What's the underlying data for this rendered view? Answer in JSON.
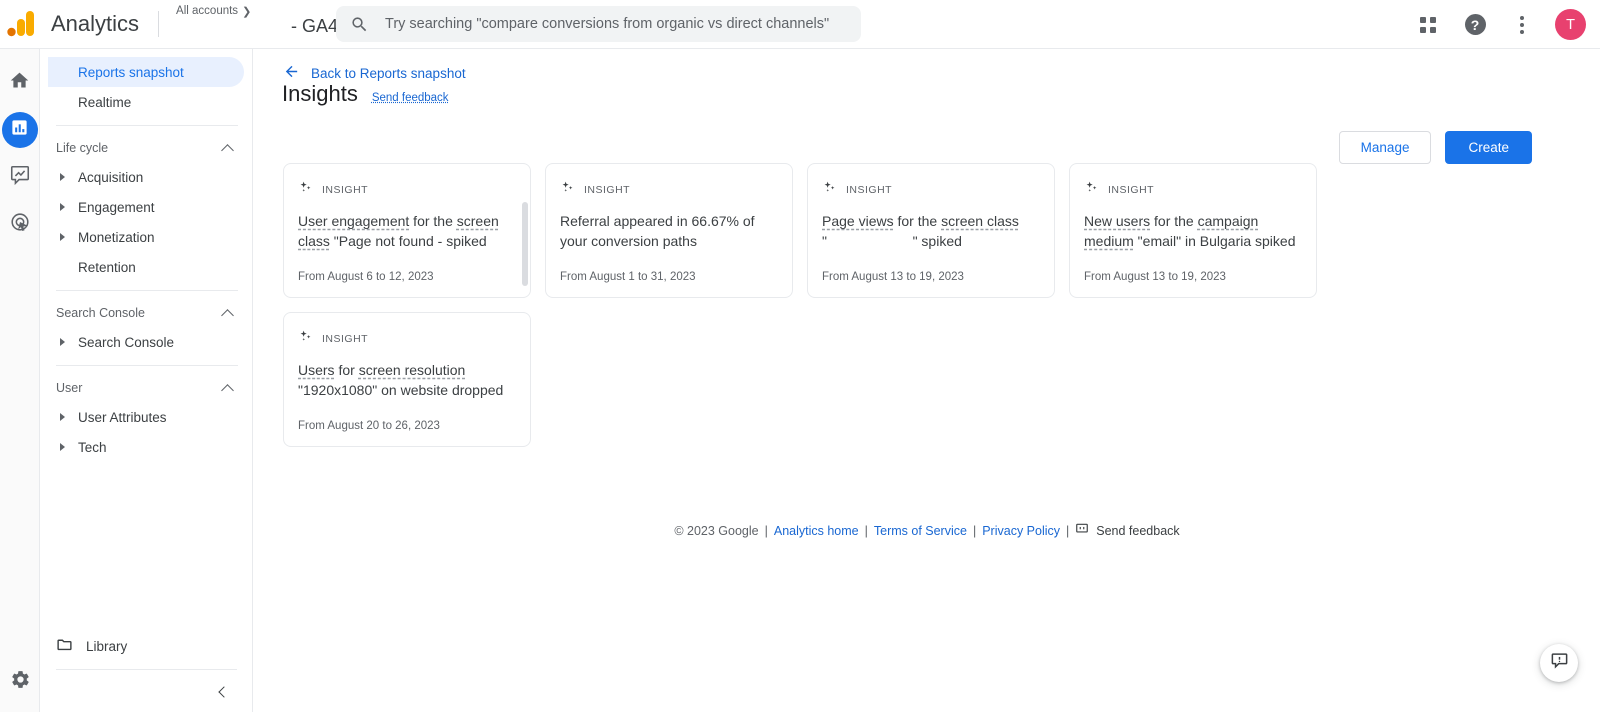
{
  "header": {
    "brand": "Analytics",
    "all_accounts": "All accounts",
    "all_accounts_chevron": "chevron-right-icon",
    "property_name": "- GA4",
    "search_placeholder": "Try searching \"compare conversions from organic vs direct channels\"",
    "search_value": "",
    "apps_icon": "apps-grid-icon",
    "help_icon": "help-icon",
    "help_glyph": "?",
    "more_icon": "more-vert-icon",
    "avatar_initial": "T",
    "avatar_color": "#e8416f"
  },
  "rail": {
    "items": [
      {
        "name": "home-icon",
        "label": "Home",
        "active": false
      },
      {
        "name": "reports-icon",
        "label": "Reports",
        "active": true
      },
      {
        "name": "explore-icon",
        "label": "Explore",
        "active": false
      },
      {
        "name": "advertising-icon",
        "label": "Advertising",
        "active": false
      }
    ],
    "settings": {
      "name": "gear-icon",
      "label": "Admin"
    },
    "active_color": "#1a73e8"
  },
  "sidebar": {
    "items": [
      {
        "label": "Reports snapshot",
        "selected": true,
        "expandable": false
      },
      {
        "label": "Realtime",
        "selected": false,
        "expandable": false
      }
    ],
    "groups": [
      {
        "title": "Life cycle",
        "collapse_icon": "chevron-up-icon",
        "items": [
          {
            "label": "Acquisition",
            "expandable": true
          },
          {
            "label": "Engagement",
            "expandable": true
          },
          {
            "label": "Monetization",
            "expandable": true
          },
          {
            "label": "Retention",
            "expandable": false
          }
        ]
      },
      {
        "title": "Search Console",
        "collapse_icon": "chevron-up-icon",
        "items": [
          {
            "label": "Search Console",
            "expandable": true
          }
        ]
      },
      {
        "title": "User",
        "collapse_icon": "chevron-up-icon",
        "items": [
          {
            "label": "User Attributes",
            "expandable": true
          },
          {
            "label": "Tech",
            "expandable": true
          }
        ]
      }
    ],
    "library": {
      "label": "Library",
      "icon": "folder-icon"
    },
    "collapse": {
      "icon": "chevron-left-icon",
      "label": "Collapse navigation"
    }
  },
  "main": {
    "back_link": "Back to Reports snapshot",
    "back_icon": "arrow-left-icon",
    "title": "Insights",
    "send_feedback": "Send feedback",
    "manage_label": "Manage",
    "create_label": "Create",
    "kicker": "INSIGHT",
    "insight_icon": "sparkle-icon",
    "cards": [
      {
        "kicker": "INSIGHT",
        "segments": [
          {
            "text": "User engagement",
            "underline": true
          },
          {
            "text": " for the ",
            "underline": false
          },
          {
            "text": "screen class",
            "underline": true
          },
          {
            "text": " \"Page not found - ",
            "underline": false
          },
          {
            "text": "spiked",
            "underline": false
          }
        ],
        "plain": "User engagement for the screen class \"Page not found - spiked",
        "date": "From August 6 to 12, 2023",
        "has_scrollbar": true
      },
      {
        "kicker": "INSIGHT",
        "segments": [
          {
            "text": "Referral appeared in 66.67% of your conversion paths",
            "underline": false
          }
        ],
        "plain": "Referral appeared in 66.67% of your conversion paths",
        "date": "From August 1 to 31, 2023",
        "has_scrollbar": false
      },
      {
        "kicker": "INSIGHT",
        "segments": [
          {
            "text": "Page views",
            "underline": true
          },
          {
            "text": " for the ",
            "underline": false
          },
          {
            "text": "screen class",
            "underline": true
          },
          {
            "text": " \"",
            "underline": false
          },
          {
            "text": "                      ",
            "underline": false
          },
          {
            "text": "\" spiked",
            "underline": false
          }
        ],
        "plain": "Page views for the screen class \"                      \" spiked",
        "date": "From August 13 to 19, 2023",
        "has_scrollbar": false
      },
      {
        "kicker": "INSIGHT",
        "segments": [
          {
            "text": "New users",
            "underline": true
          },
          {
            "text": " for the ",
            "underline": false
          },
          {
            "text": "campaign medium",
            "underline": true
          },
          {
            "text": " \"email\" in Bulgaria spiked",
            "underline": false
          }
        ],
        "plain": "New users for the campaign medium \"email\" in Bulgaria spiked",
        "date": "From August 13 to 19, 2023",
        "has_scrollbar": false
      },
      {
        "kicker": "INSIGHT",
        "segments": [
          {
            "text": "Users",
            "underline": true
          },
          {
            "text": " for ",
            "underline": false
          },
          {
            "text": "screen resolution",
            "underline": true
          },
          {
            "text": " \"1920x1080\" on website dropped",
            "underline": false
          }
        ],
        "plain": "Users for screen resolution \"1920x1080\" on website dropped",
        "date": "From August 20 to 26, 2023",
        "has_scrollbar": false
      }
    ]
  },
  "footer": {
    "copyright": "© 2023 Google",
    "links": [
      "Analytics home",
      "Terms of Service",
      "Privacy Policy"
    ],
    "separator": "|",
    "send_feedback": "Send feedback",
    "feedback_icon": "feedback-icon"
  },
  "fab": {
    "icon": "feedback-icon",
    "label": "Send feedback"
  }
}
